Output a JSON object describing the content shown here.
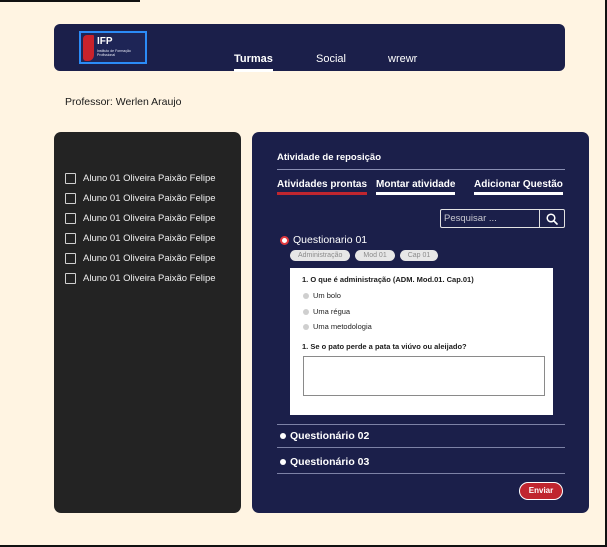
{
  "header": {
    "logo_text": "IFP",
    "logo_subtitle": "Instituto de Formação Profissional",
    "tabs": [
      {
        "label": "Turmas",
        "active": true
      },
      {
        "label": "Social",
        "active": false
      },
      {
        "label": "wrewr",
        "active": false
      }
    ]
  },
  "teacher": {
    "label": "Professor: Werlen Araujo"
  },
  "students": [
    {
      "name": "Aluno 01 Oliveira Paixão Felipe",
      "checked": false
    },
    {
      "name": "Aluno 01 Oliveira Paixão Felipe",
      "checked": false
    },
    {
      "name": "Aluno 01 Oliveira Paixão Felipe",
      "checked": false
    },
    {
      "name": "Aluno 01 Oliveira Paixão Felipe",
      "checked": false
    },
    {
      "name": "Aluno 01 Oliveira Paixão Felipe",
      "checked": false
    },
    {
      "name": "Aluno 01 Oliveira Paixão Felipe",
      "checked": false
    }
  ],
  "panel": {
    "title": "Atividade de reposição",
    "tabs": [
      {
        "label": "Atividades prontas",
        "active": true
      },
      {
        "label": "Montar atividade",
        "active": false
      },
      {
        "label": "Adicionar Questão",
        "active": false
      }
    ],
    "search": {
      "placeholder": "Pesquisar ...",
      "value": ""
    },
    "questionnaires": [
      {
        "title": "Questionario 01",
        "expanded": true,
        "tags": [
          "Administração",
          "Mod 01",
          "Cap 01"
        ],
        "questions": [
          {
            "text": "1. O que é administração (ADM. Mod.01. Cap.01)",
            "options": [
              "Um bolo",
              "Uma régua",
              "Uma metodologia"
            ]
          },
          {
            "text": "1. Se o pato perde a pata ta viúvo ou aleijado?",
            "answer": ""
          }
        ]
      },
      {
        "title": "Questionário 02",
        "expanded": false
      },
      {
        "title": "Questionário 03",
        "expanded": false
      }
    ],
    "send_label": "Enviar"
  },
  "colors": {
    "background": "#fff4e2",
    "navy": "#1b1f4a",
    "dark_panel": "#232323",
    "accent_red": "#c0262f"
  }
}
